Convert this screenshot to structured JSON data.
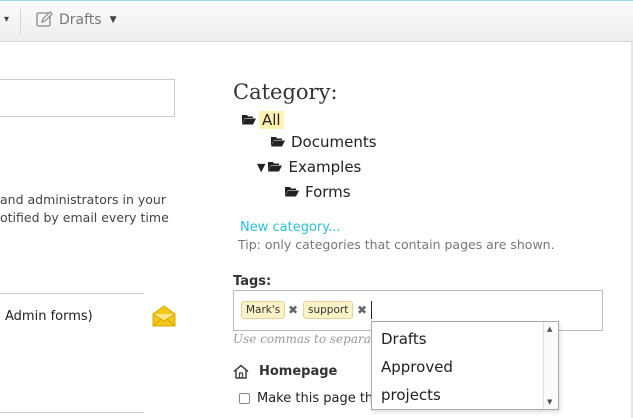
{
  "toolbar": {
    "drafts_label": "Drafts"
  },
  "left_panel": {
    "description_line1": "and administrators in your",
    "description_line2": "otified by email every time",
    "admin_forms_label": "Admin forms)"
  },
  "category": {
    "title": "Category:",
    "tree": [
      {
        "label": "All",
        "selected": true
      },
      {
        "label": "Documents"
      },
      {
        "label": "Examples",
        "expanded": true
      },
      {
        "label": "Forms"
      }
    ],
    "new_category_link": "New category...",
    "tip": "Tip: only categories that contain pages are shown."
  },
  "tags": {
    "label": "Tags:",
    "items": [
      "Mark's",
      "support"
    ],
    "hint": "Use commas to separate",
    "suggestions": [
      "Drafts",
      "Approved",
      "projects"
    ]
  },
  "homepage": {
    "label": "Homepage",
    "checkbox_label": "Make this page the"
  },
  "colors": {
    "link": "#2cc0dc",
    "tag_bg": "#fdf1c7",
    "selected_bg": "#fff2b3",
    "envelope": "#f2c518"
  }
}
